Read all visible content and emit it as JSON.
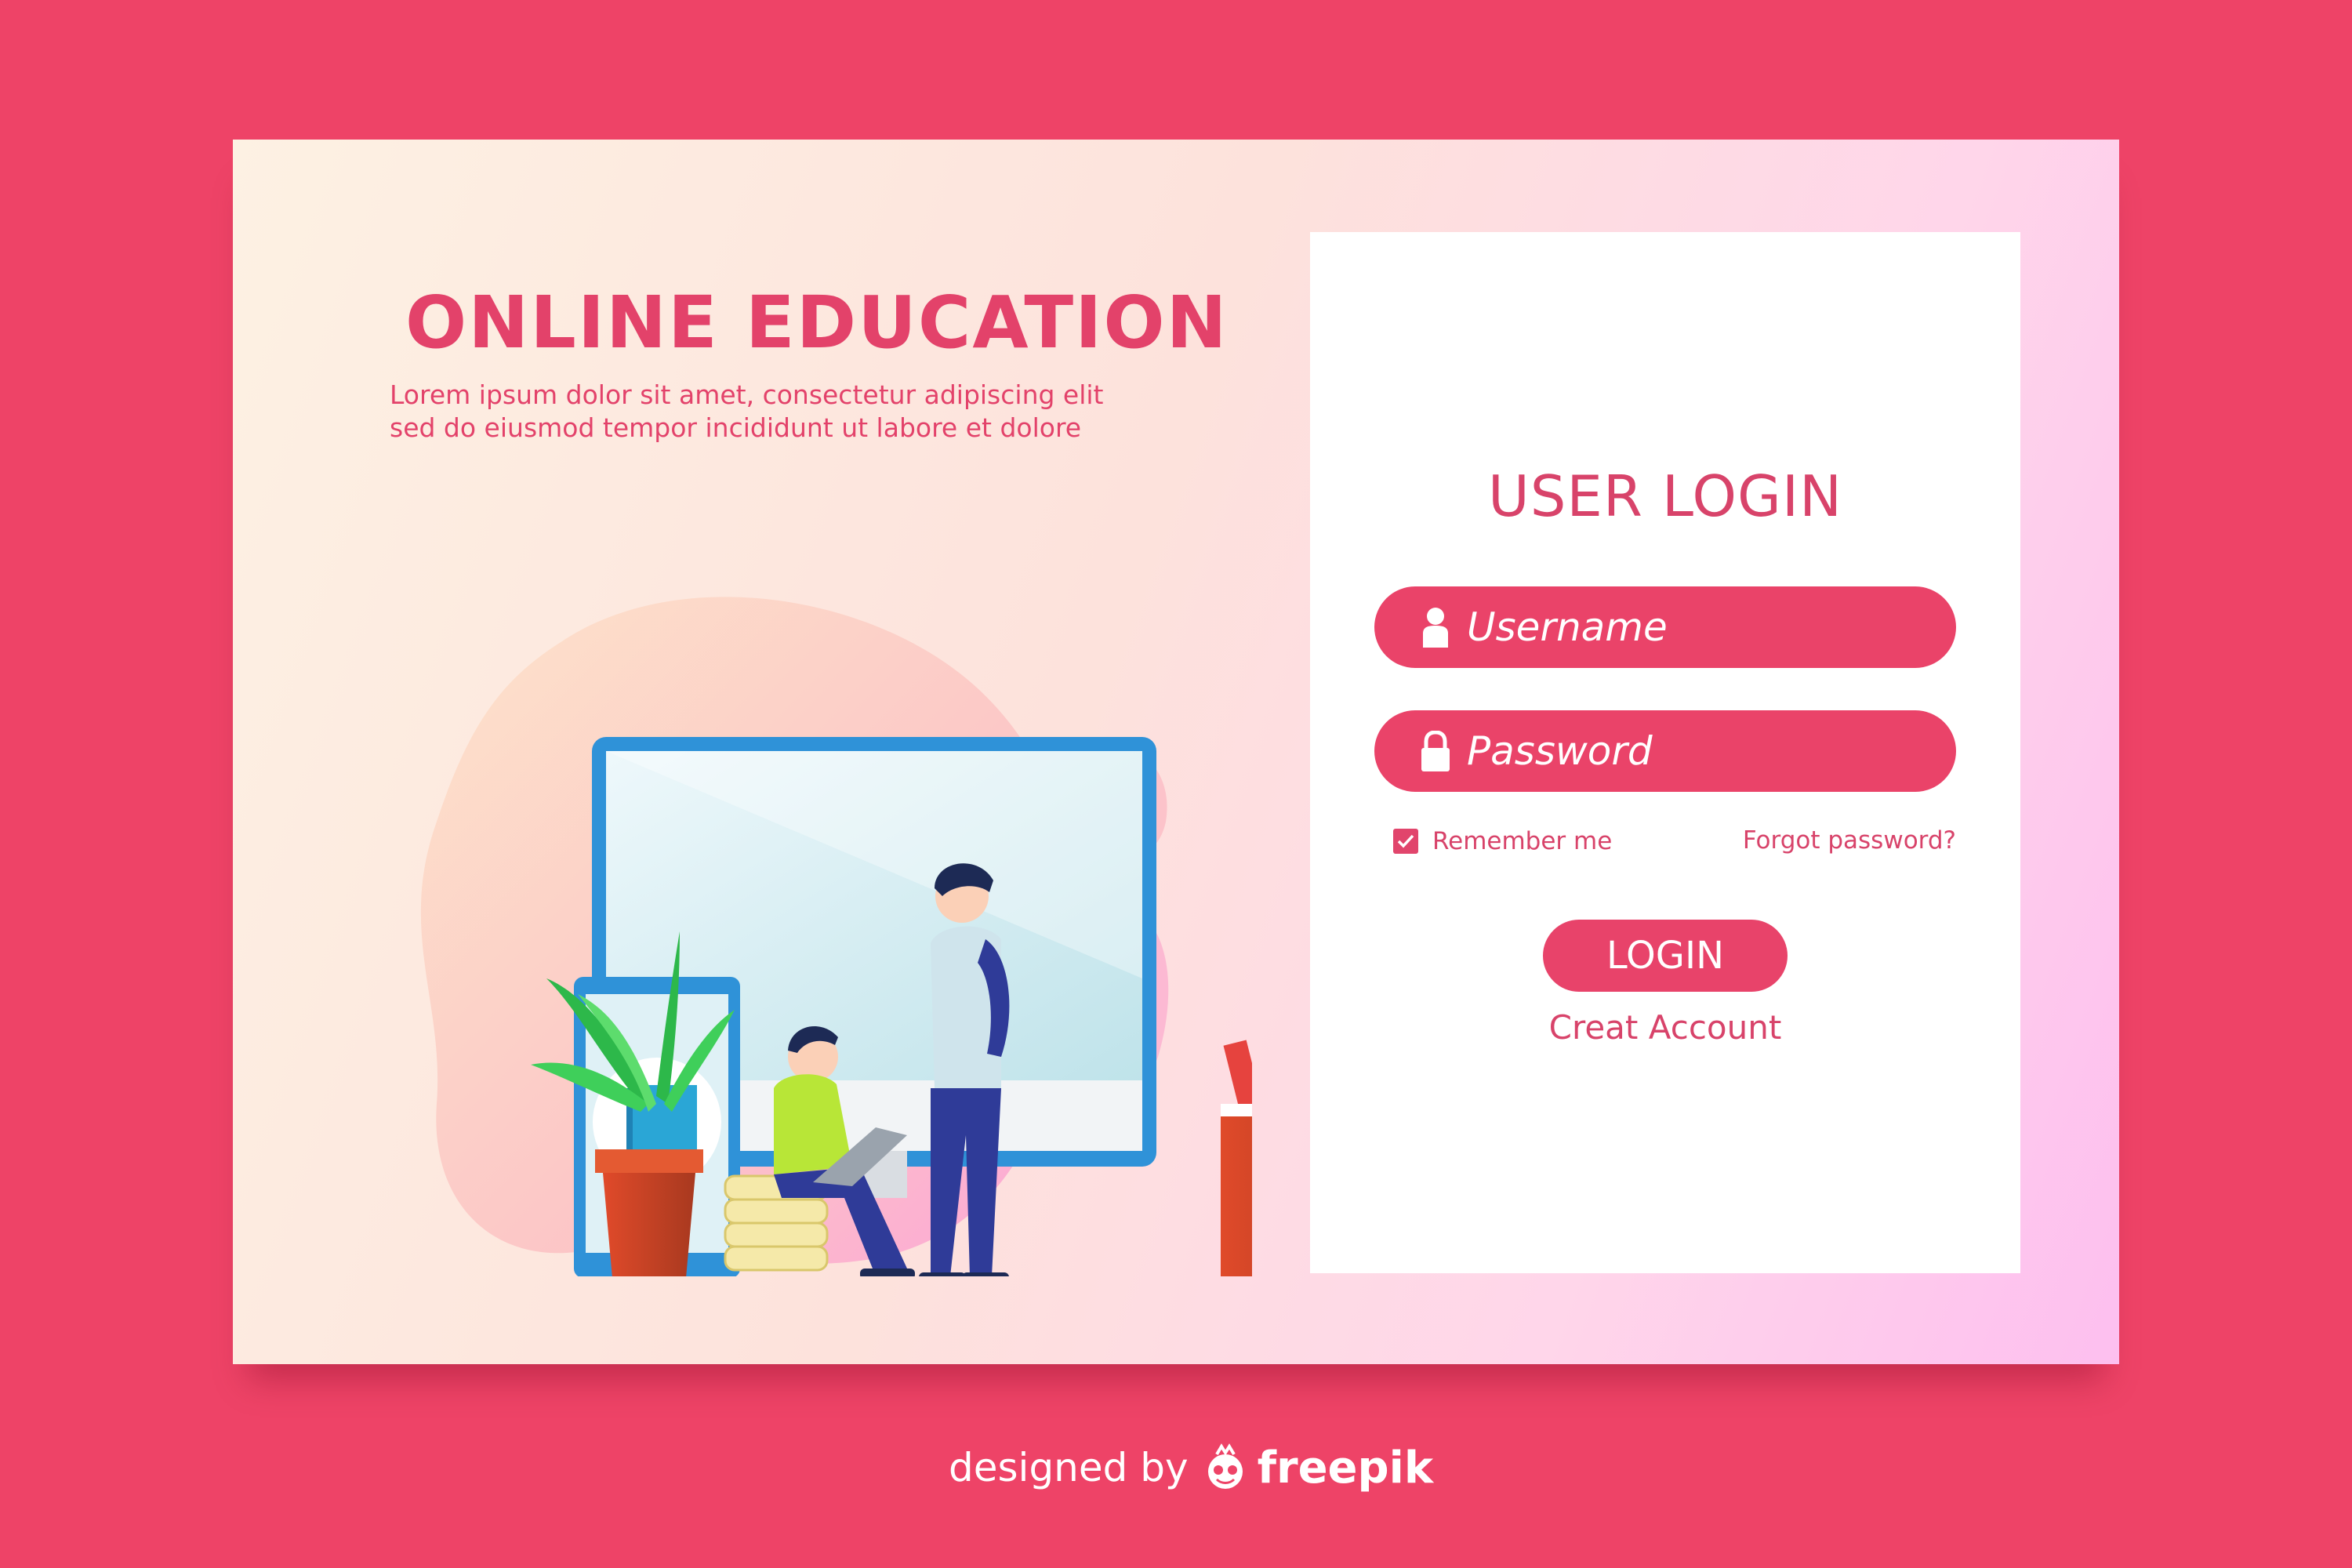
{
  "hero": {
    "title": "ONLINE EDUCATION",
    "subtitle_line1": "Lorem ipsum dolor sit amet, consectetur adipiscing elit",
    "subtitle_line2": "sed do eiusmod tempor incididunt ut labore et dolore"
  },
  "login": {
    "title": "USER LOGIN",
    "username_placeholder": "Username",
    "password_placeholder": "Password",
    "remember_label": "Remember me",
    "remember_checked": true,
    "forgot_label": "Forgot password?",
    "login_button": "LOGIN",
    "create_account": "Creat Account"
  },
  "footer": {
    "designed_by": "designed by",
    "brand": "freepik"
  },
  "icons": {
    "username": "user-icon",
    "password": "lock-icon",
    "remember": "checkbox-icon",
    "brand": "freepik-logo-icon"
  },
  "colors": {
    "background": "#ee4367",
    "accent": "#e8436a",
    "panel": "#ffffff"
  }
}
